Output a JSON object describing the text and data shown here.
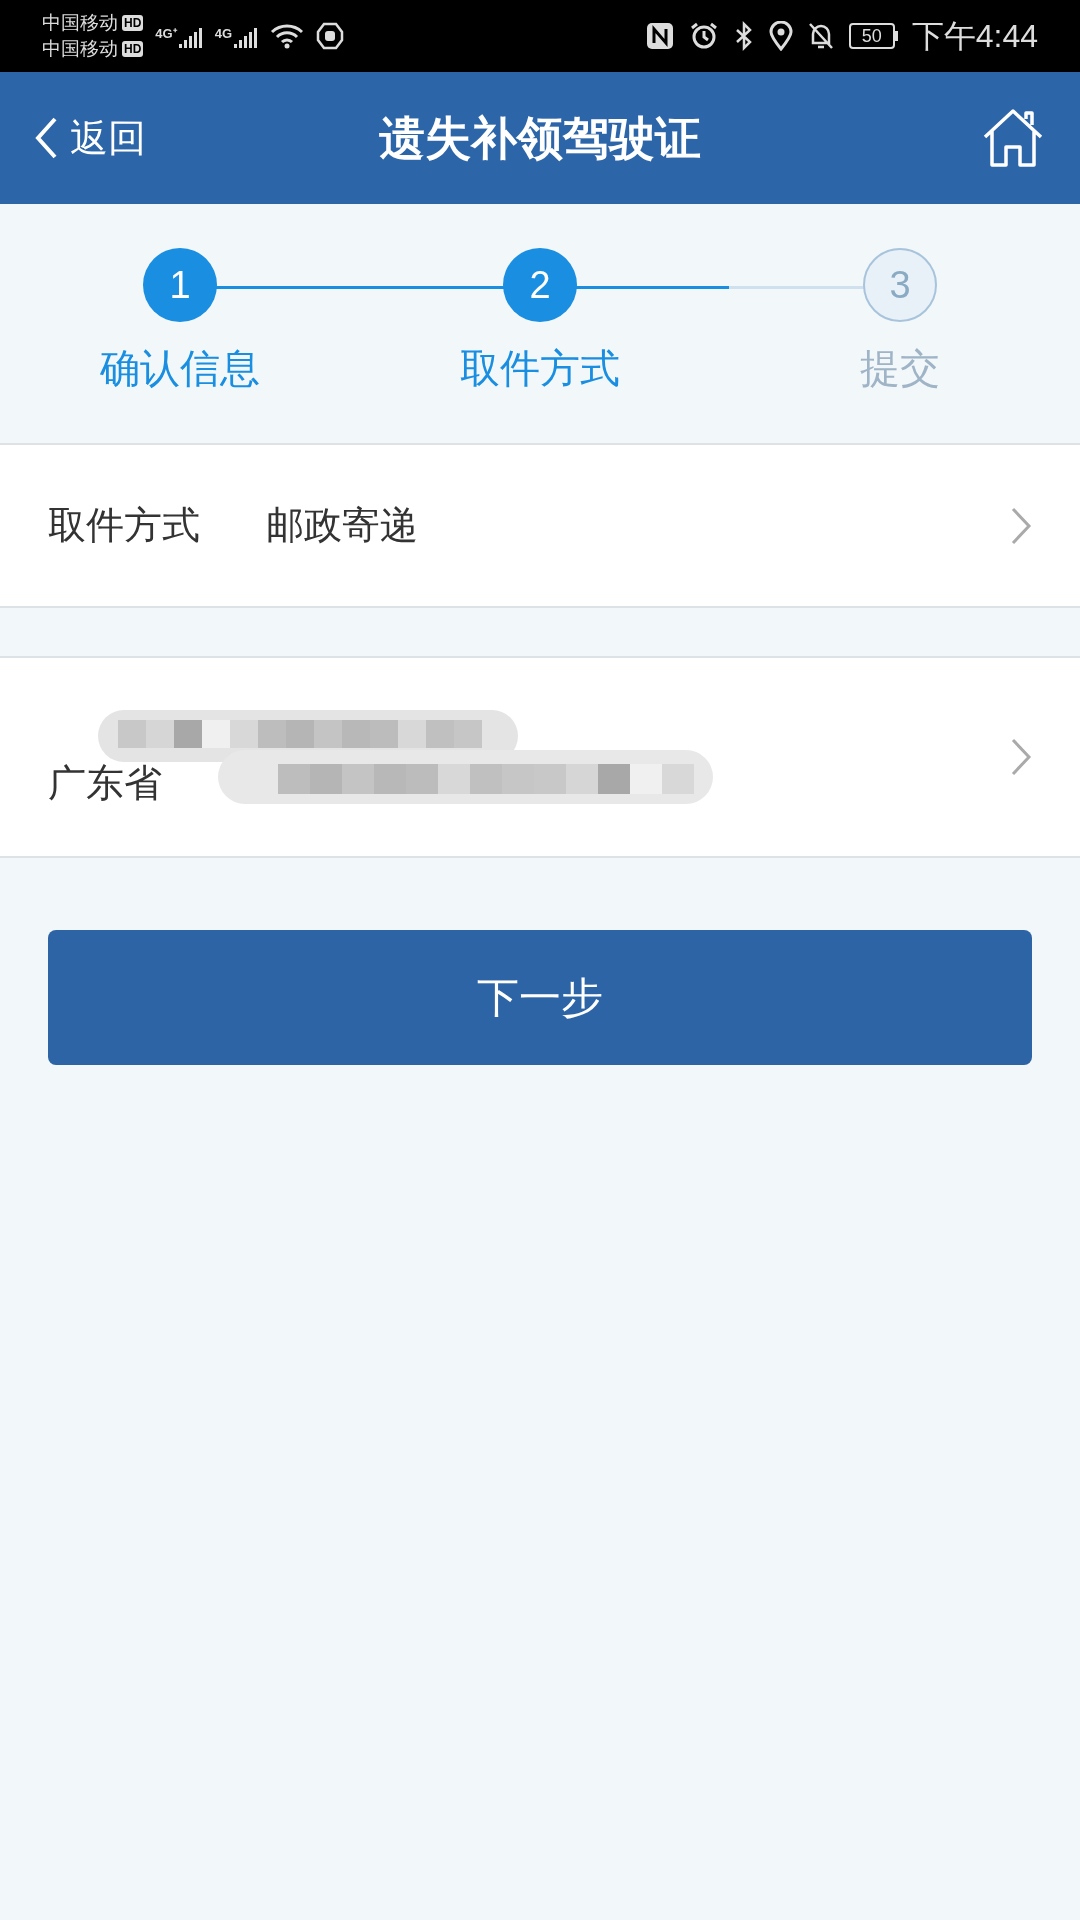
{
  "status_bar": {
    "carriers": [
      "中国移动",
      "中国移动"
    ],
    "hd_badges": [
      "HD",
      "HD"
    ],
    "network_labels": [
      "4G⁺",
      "4G"
    ],
    "battery": "50",
    "time": "下午4:44"
  },
  "header": {
    "back_label": "返回",
    "title": "遗失补领驾驶证"
  },
  "steps": [
    {
      "number": "1",
      "label": "确认信息",
      "kind": "done"
    },
    {
      "number": "2",
      "label": "取件方式",
      "kind": "current"
    },
    {
      "number": "3",
      "label": "提交",
      "kind": "pending"
    }
  ],
  "pickup_row": {
    "label": "取件方式",
    "value": "邮政寄递"
  },
  "address_row": {
    "line_2": "广东省"
  },
  "next_button": "下一步"
}
